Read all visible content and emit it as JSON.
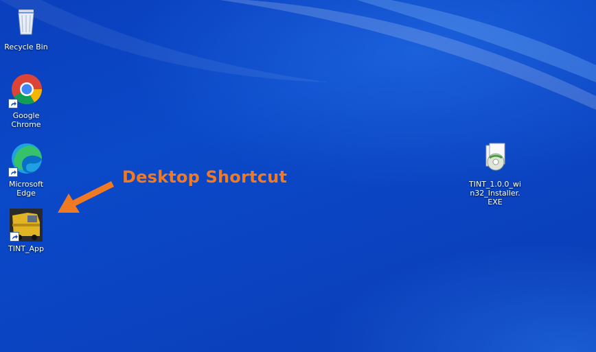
{
  "desktop": {
    "icons": [
      {
        "label": "Recycle Bin",
        "icon": "recycle-bin-icon"
      },
      {
        "label": "Google\nChrome",
        "icon": "chrome-icon"
      },
      {
        "label": "Microsoft Edge",
        "icon": "edge-icon"
      },
      {
        "label": "TINT_App",
        "icon": "truck-app-icon"
      },
      {
        "label": "TINT_1.0.0_win32_Installer.EXE",
        "icon": "installer-icon"
      }
    ],
    "callout_text": "Desktop Shortcut",
    "callout_color": "#f07a24"
  }
}
